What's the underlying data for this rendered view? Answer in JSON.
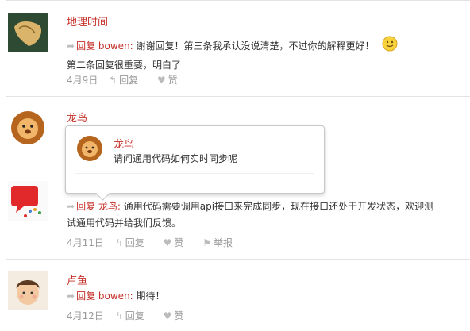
{
  "comments": [
    {
      "username": "地理时间",
      "avatar": "leaf-avatar",
      "reply_prefix": "回复",
      "reply_target": "bowen:",
      "text_line1": "谢谢回复！第三条我承认没说清楚，不过你的解释更好！",
      "text_line2": "第二条回复很重要，明白了",
      "emoji": "smiley-icon",
      "date": "4月9日",
      "reply_label": "回复",
      "like_label": "赞"
    },
    {
      "username": "龙鸟",
      "avatar": "lion-avatar"
    },
    {
      "username": "",
      "avatar": "red-white-icon-avatar",
      "reply_prefix": "回复",
      "reply_target": "龙鸟:",
      "text_line1": "通用代码需要调用api接口来完成同步，现在接口还处于开发状态，欢迎测",
      "text_line2": "试通用代码并给我们反馈。",
      "date": "4月11日",
      "reply_label": "回复",
      "like_label": "赞",
      "report_label": "举报"
    },
    {
      "username": "卢鱼",
      "avatar": "boy-avatar",
      "reply_prefix": "回复",
      "reply_target": "bowen:",
      "text_line1": "期待！",
      "date": "4月12日",
      "reply_label": "回复",
      "like_label": "赞"
    }
  ],
  "popup": {
    "username": "龙鸟",
    "text": "请问通用代码如何实时同步呢"
  },
  "colors": {
    "accent": "#c6322b",
    "muted": "#999999",
    "divider": "#e3e3e3"
  }
}
